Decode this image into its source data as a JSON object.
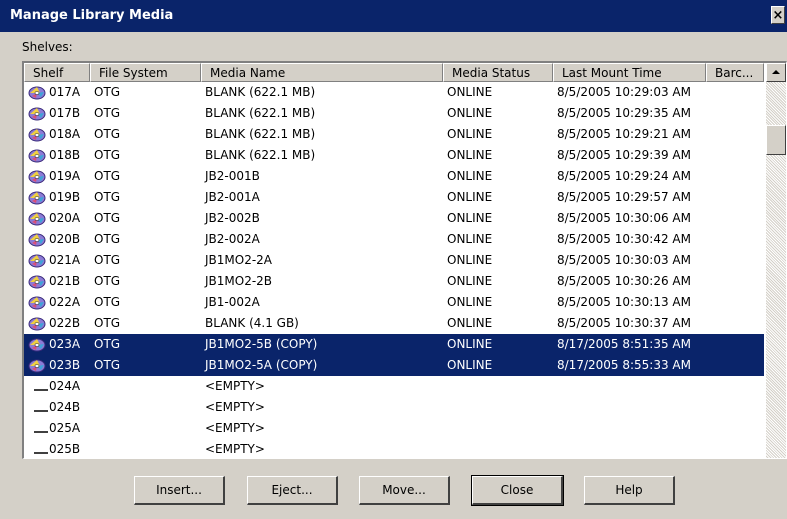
{
  "window": {
    "title": "Manage Library Media",
    "close_label": "×"
  },
  "shelves_label": "Shelves:",
  "columns": [
    "Shelf",
    "File System",
    "Media Name",
    "Media Status",
    "Last Mount Time",
    "Barc..."
  ],
  "rows": [
    {
      "shelf": "017A",
      "fs": "OTG",
      "media": "BLANK (622.1 MB)",
      "status": "ONLINE",
      "mount": "8/5/2005  10:29:03 AM",
      "icon": "disc-icon",
      "selected": false
    },
    {
      "shelf": "017B",
      "fs": "OTG",
      "media": "BLANK (622.1 MB)",
      "status": "ONLINE",
      "mount": "8/5/2005  10:29:35 AM",
      "icon": "disc-icon",
      "selected": false
    },
    {
      "shelf": "018A",
      "fs": "OTG",
      "media": "BLANK (622.1 MB)",
      "status": "ONLINE",
      "mount": "8/5/2005  10:29:21 AM",
      "icon": "disc-icon",
      "selected": false
    },
    {
      "shelf": "018B",
      "fs": "OTG",
      "media": "BLANK (622.1 MB)",
      "status": "ONLINE",
      "mount": "8/5/2005  10:29:39 AM",
      "icon": "disc-icon",
      "selected": false
    },
    {
      "shelf": "019A",
      "fs": "OTG",
      "media": "JB2-001B",
      "status": "ONLINE",
      "mount": "8/5/2005  10:29:24 AM",
      "icon": "disc-icon",
      "selected": false
    },
    {
      "shelf": "019B",
      "fs": "OTG",
      "media": "JB2-001A",
      "status": "ONLINE",
      "mount": "8/5/2005  10:29:57 AM",
      "icon": "disc-icon",
      "selected": false
    },
    {
      "shelf": "020A",
      "fs": "OTG",
      "media": "JB2-002B",
      "status": "ONLINE",
      "mount": "8/5/2005  10:30:06 AM",
      "icon": "disc-icon",
      "selected": false
    },
    {
      "shelf": "020B",
      "fs": "OTG",
      "media": "JB2-002A",
      "status": "ONLINE",
      "mount": "8/5/2005  10:30:42 AM",
      "icon": "disc-icon",
      "selected": false
    },
    {
      "shelf": "021A",
      "fs": "OTG",
      "media": "JB1MO2-2A",
      "status": "ONLINE",
      "mount": "8/5/2005  10:30:03 AM",
      "icon": "disc-icon",
      "selected": false
    },
    {
      "shelf": "021B",
      "fs": "OTG",
      "media": "JB1MO2-2B",
      "status": "ONLINE",
      "mount": "8/5/2005  10:30:26 AM",
      "icon": "disc-icon",
      "selected": false
    },
    {
      "shelf": "022A",
      "fs": "OTG",
      "media": "JB1-002A",
      "status": "ONLINE",
      "mount": "8/5/2005  10:30:13 AM",
      "icon": "disc-icon",
      "selected": false
    },
    {
      "shelf": "022B",
      "fs": "OTG",
      "media": "BLANK (4.1 GB)",
      "status": "ONLINE",
      "mount": "8/5/2005  10:30:37 AM",
      "icon": "disc-icon",
      "selected": false
    },
    {
      "shelf": "023A",
      "fs": "OTG",
      "media": "JB1MO2-5B  (COPY)",
      "status": "ONLINE",
      "mount": "8/17/2005  8:51:35 AM",
      "icon": "disc-icon",
      "selected": true
    },
    {
      "shelf": "023B",
      "fs": "OTG",
      "media": "JB1MO2-5A  (COPY)",
      "status": "ONLINE",
      "mount": "8/17/2005  8:55:33 AM",
      "icon": "disc-icon",
      "selected": true
    },
    {
      "shelf": "024A",
      "fs": "",
      "media": "<EMPTY>",
      "status": "",
      "mount": "",
      "icon": "empty-slot-icon",
      "selected": false
    },
    {
      "shelf": "024B",
      "fs": "",
      "media": "<EMPTY>",
      "status": "",
      "mount": "",
      "icon": "empty-slot-icon",
      "selected": false
    },
    {
      "shelf": "025A",
      "fs": "",
      "media": "<EMPTY>",
      "status": "",
      "mount": "",
      "icon": "empty-slot-icon",
      "selected": false
    },
    {
      "shelf": "025B",
      "fs": "",
      "media": "<EMPTY>",
      "status": "",
      "mount": "",
      "icon": "empty-slot-icon",
      "selected": false
    }
  ],
  "buttons": {
    "insert": "Insert...",
    "eject": "Eject...",
    "move": "Move...",
    "close": "Close",
    "help": "Help"
  },
  "colors": {
    "title_bg": "#0a246a",
    "selection_bg": "#0a246a",
    "face": "#d4d0c8"
  }
}
